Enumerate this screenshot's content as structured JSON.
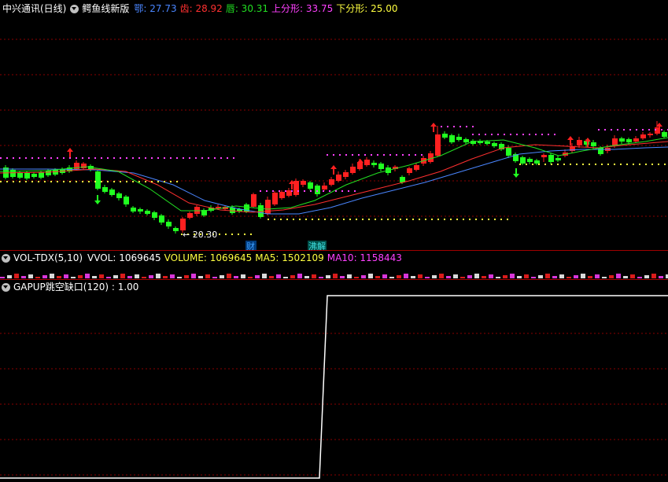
{
  "main_panel": {
    "stock_title": "中兴通讯(日线)",
    "indicator_name": "鳄鱼线新版",
    "legend": [
      {
        "label": "鄂: 27.73",
        "color": "#4a86ff"
      },
      {
        "label": "齿: 28.92",
        "color": "#ff3030"
      },
      {
        "label": "唇: 30.31",
        "color": "#22e022"
      },
      {
        "label": "上分形: 33.75",
        "color": "#ff40ff"
      },
      {
        "label": "下分形: 25.00",
        "color": "#ffff40"
      }
    ],
    "low_marker": "20.30",
    "badges": [
      {
        "text": "财",
        "color": "#3fa0ff"
      },
      {
        "text": "沸解",
        "color": "#3fe0e0"
      }
    ]
  },
  "volume_panel": {
    "indicator_name": "VOL-TDX(5,10)",
    "legend": [
      {
        "label": "VVOL: 1069645",
        "color": "#ffffff"
      },
      {
        "label": "VOLUME: 1069645",
        "color": "#ffff40"
      },
      {
        "label": "MA5: 1502109",
        "color": "#ffff40"
      },
      {
        "label": "MA10: 1158443",
        "color": "#ff40ff"
      }
    ]
  },
  "gap_panel": {
    "indicator_label": "GAPUP跳空缺口(120) : 1.00"
  },
  "colors": {
    "up": "#ff2020",
    "down": "#20ff20",
    "flat": "#e0e0e0",
    "grid": "#8a0000"
  }
}
